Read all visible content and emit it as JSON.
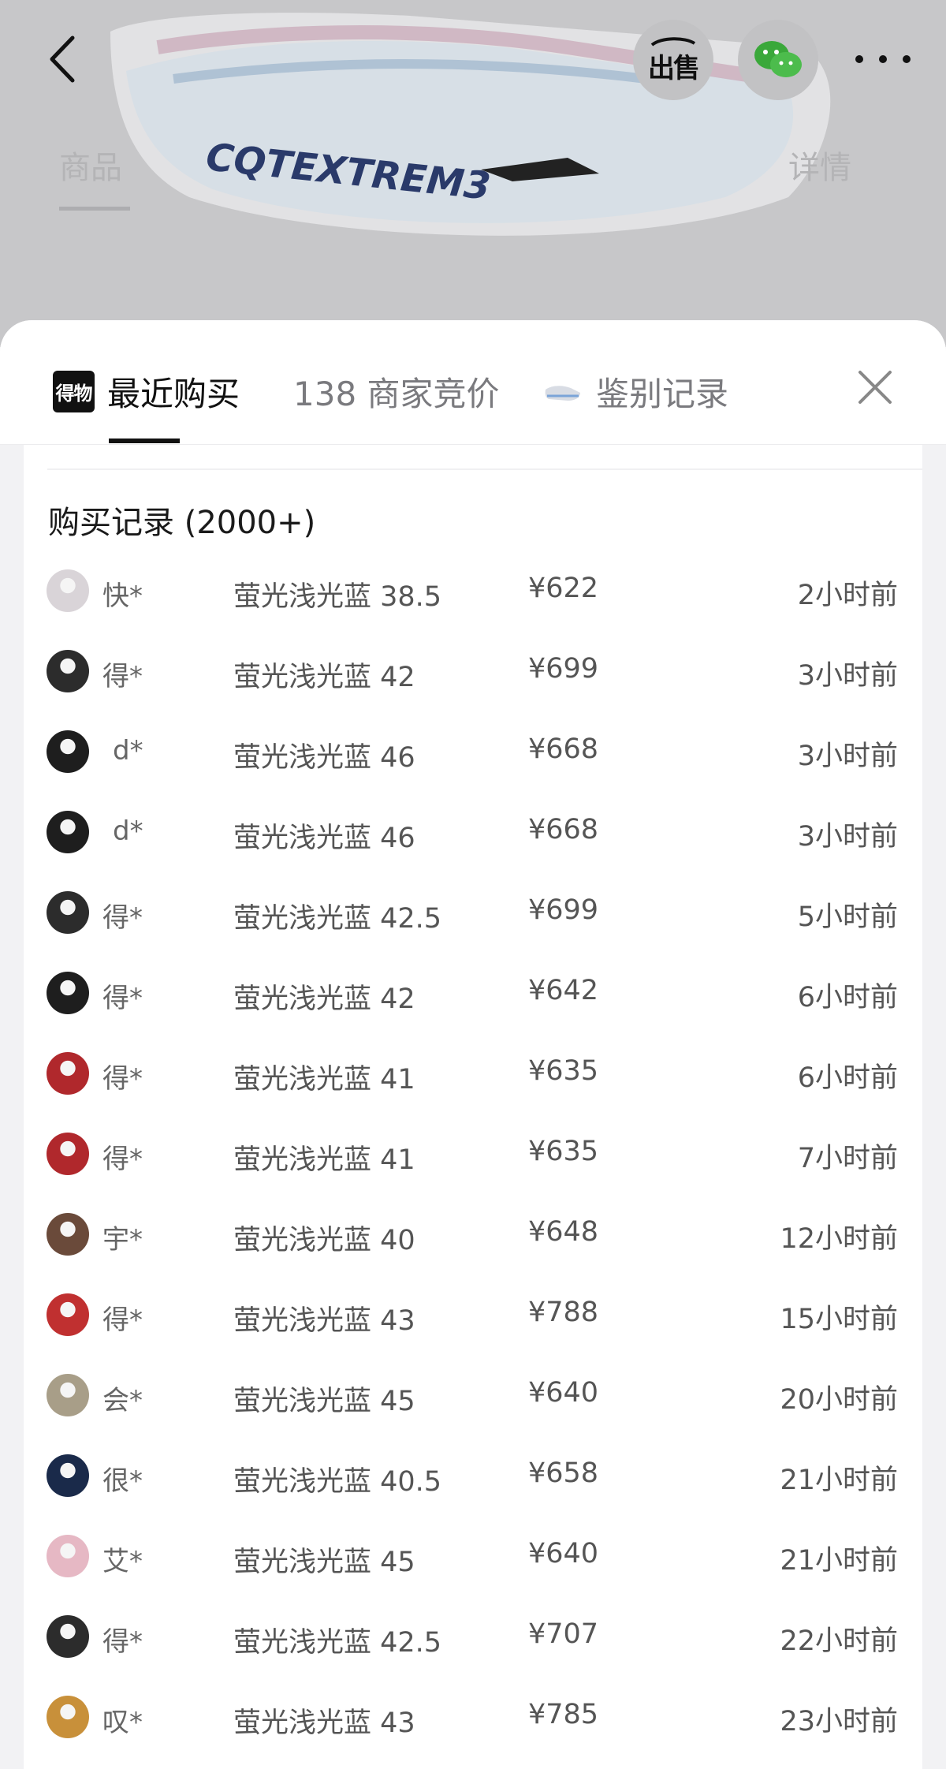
{
  "background": {
    "tab_product": "商品",
    "tab_detail": "详情"
  },
  "header_icons": {
    "back": "chevron-left-icon",
    "sell": "出售",
    "wechat": "wechat-icon",
    "more": "more-dots-icon"
  },
  "tabs": {
    "recent_purchase": "最近购买",
    "merchant_bids": "138 商家竞价",
    "auth_records": "鉴别记录",
    "brand_icon_text": "得物"
  },
  "records": {
    "title": "购买记录 (2000+)",
    "rows": [
      {
        "user": "快*",
        "spec": "萤光浅光蓝 38.5",
        "price": "¥622",
        "time": "2小时前",
        "avatar": "#d9d4d8"
      },
      {
        "user": "得*",
        "spec": "萤光浅光蓝 42",
        "price": "¥699",
        "time": "3小时前",
        "avatar": "#2c2c2c"
      },
      {
        "user": "d*",
        "spec": "萤光浅光蓝 46",
        "price": "¥668",
        "time": "3小时前",
        "avatar": "#1e1e1e",
        "indent": true
      },
      {
        "user": "d*",
        "spec": "萤光浅光蓝 46",
        "price": "¥668",
        "time": "3小时前",
        "avatar": "#1e1e1e",
        "indent": true
      },
      {
        "user": "得*",
        "spec": "萤光浅光蓝 42.5",
        "price": "¥699",
        "time": "5小时前",
        "avatar": "#2c2c2c"
      },
      {
        "user": "得*",
        "spec": "萤光浅光蓝 42",
        "price": "¥642",
        "time": "6小时前",
        "avatar": "#1e1e1e"
      },
      {
        "user": "得*",
        "spec": "萤光浅光蓝 41",
        "price": "¥635",
        "time": "6小时前",
        "avatar": "#b0282c"
      },
      {
        "user": "得*",
        "spec": "萤光浅光蓝 41",
        "price": "¥635",
        "time": "7小时前",
        "avatar": "#b0282c"
      },
      {
        "user": "宇*",
        "spec": "萤光浅光蓝 40",
        "price": "¥648",
        "time": "12小时前",
        "avatar": "#6a4a3a"
      },
      {
        "user": "得*",
        "spec": "萤光浅光蓝 43",
        "price": "¥788",
        "time": "15小时前",
        "avatar": "#c03030"
      },
      {
        "user": "会*",
        "spec": "萤光浅光蓝 45",
        "price": "¥640",
        "time": "20小时前",
        "avatar": "#a89e88"
      },
      {
        "user": "很*",
        "spec": "萤光浅光蓝 40.5",
        "price": "¥658",
        "time": "21小时前",
        "avatar": "#1a2a4a"
      },
      {
        "user": "艾*",
        "spec": "萤光浅光蓝 45",
        "price": "¥640",
        "time": "21小时前",
        "avatar": "#e6b8c4"
      },
      {
        "user": "得*",
        "spec": "萤光浅光蓝 42.5",
        "price": "¥707",
        "time": "22小时前",
        "avatar": "#2c2c2c"
      },
      {
        "user": "叹*",
        "spec": "萤光浅光蓝 43",
        "price": "¥785",
        "time": "23小时前",
        "avatar": "#c8903a"
      }
    ]
  }
}
